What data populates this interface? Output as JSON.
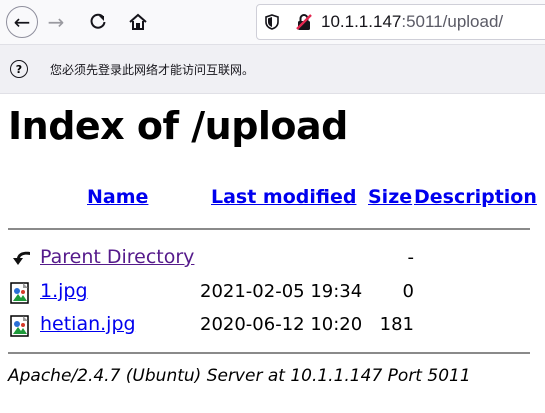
{
  "browser": {
    "url_host": "10.1.1.147",
    "url_rest": ":5011/upload/",
    "notice": "您必须先登录此网络才能访问互联网。"
  },
  "page": {
    "title": "Index of /upload",
    "columns": {
      "name": "Name",
      "last_modified": "Last modified",
      "size": "Size",
      "description": "Description"
    },
    "entries": [
      {
        "name": "Parent Directory",
        "date": "",
        "size": "-",
        "icon": "back-arrow-icon"
      },
      {
        "name": "1.jpg",
        "date": "2021-02-05 19:34",
        "size": "0",
        "icon": "image-file-icon"
      },
      {
        "name": "hetian.jpg",
        "date": "2020-06-12 10:20",
        "size": "181",
        "icon": "image-file-icon"
      }
    ],
    "footer": "Apache/2.4.7 (Ubuntu) Server at 10.1.1.147 Port 5011"
  },
  "colors": {
    "link": "#0000ee",
    "visited_link": "#551a8b"
  }
}
